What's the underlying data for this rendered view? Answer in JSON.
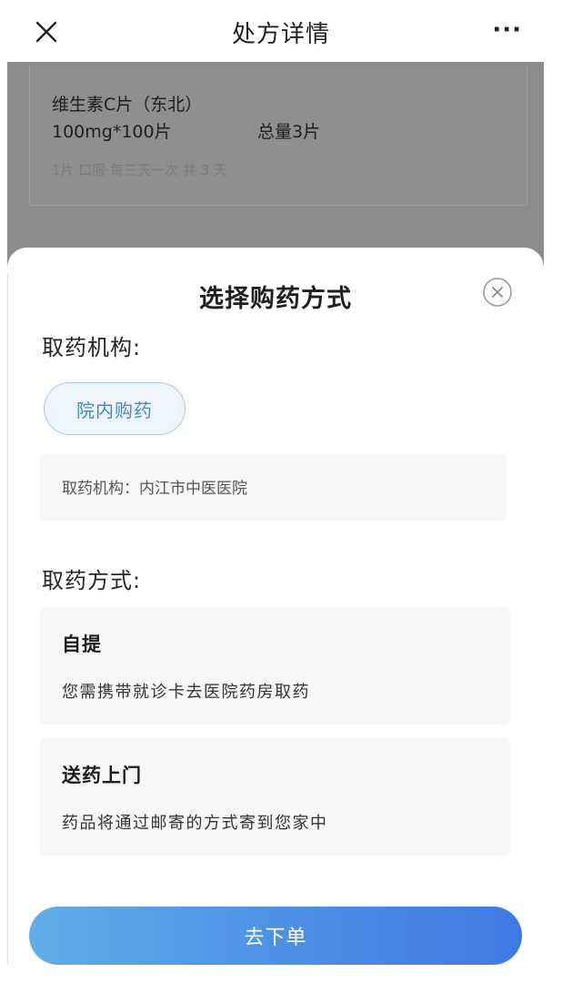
{
  "navbar": {
    "title": "处方详情",
    "more": "···"
  },
  "background_card": {
    "drug_name": "维生素C片（东北）",
    "spec": "100mg*100片",
    "total": "总量3片",
    "usage": "1片 口服 每三天一次 共 3 天"
  },
  "sheet": {
    "title": "选择购药方式",
    "institution_label": "取药机构:",
    "institution_chip": "院内购药",
    "institution_info": "取药机构：内江市中医医院",
    "method_label": "取药方式:",
    "options": [
      {
        "title": "自提",
        "desc": "您需携带就诊卡去医院药房取药"
      },
      {
        "title": "送药上门",
        "desc": "药品将通过邮寄的方式寄到您家中"
      }
    ],
    "submit_label": "去下单"
  },
  "colors": {
    "accent": "#4a8ce6",
    "chip_text": "#4a86c9",
    "overlay": "#8c8c8c"
  }
}
